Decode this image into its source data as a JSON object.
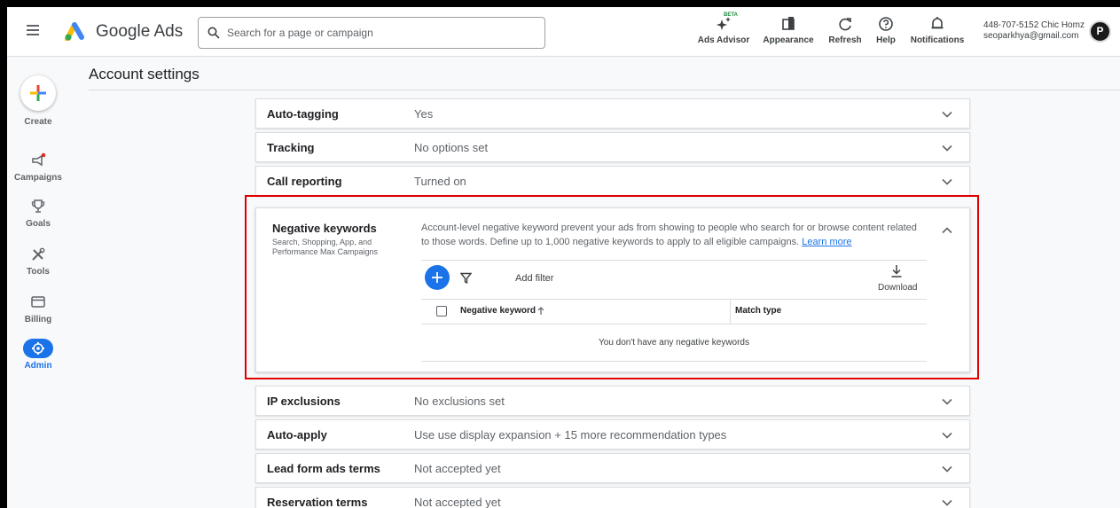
{
  "header": {
    "brand": "Google Ads",
    "search_placeholder": "Search for a page or campaign",
    "tools": {
      "ads_advisor": "Ads Advisor",
      "beta": "BETA",
      "appearance": "Appearance",
      "refresh": "Refresh",
      "help": "Help",
      "notifications": "Notifications"
    },
    "account": {
      "line1": "448-707-5152 Chic Homz",
      "line2": "seoparkhya@gmail.com"
    },
    "avatar_letter": "P"
  },
  "nav": {
    "create": "Create",
    "campaigns": "Campaigns",
    "goals": "Goals",
    "tools": "Tools",
    "billing": "Billing",
    "admin": "Admin"
  },
  "page_title": "Account settings",
  "rows_top": [
    {
      "label": "Auto-tagging",
      "value": "Yes"
    },
    {
      "label": "Tracking",
      "value": "No options set"
    },
    {
      "label": "Call reporting",
      "value": "Turned on"
    }
  ],
  "negative_keywords": {
    "title": "Negative keywords",
    "subtitle": "Search, Shopping, App, and Performance Max Campaigns",
    "description": "Account-level negative keyword prevent your ads from showing to people who search for or browse content related to those words. Define up to 1,000 negative keywords to apply to all eligible campaigns.",
    "learn_more": "Learn more",
    "add_filter": "Add filter",
    "download": "Download",
    "col_keyword": "Negative keyword",
    "col_match": "Match type",
    "empty": "You don't have any negative keywords"
  },
  "rows_bottom": [
    {
      "label": "IP exclusions",
      "value": "No exclusions set"
    },
    {
      "label": "Auto-apply",
      "value": "Use use display expansion + 15 more recommendation types"
    },
    {
      "label": "Lead form ads terms",
      "value": "Not accepted yet"
    },
    {
      "label": "Reservation terms",
      "value": "Not accepted yet"
    }
  ],
  "colors": {
    "accent": "#1a73e8",
    "highlight": "#e00000"
  }
}
